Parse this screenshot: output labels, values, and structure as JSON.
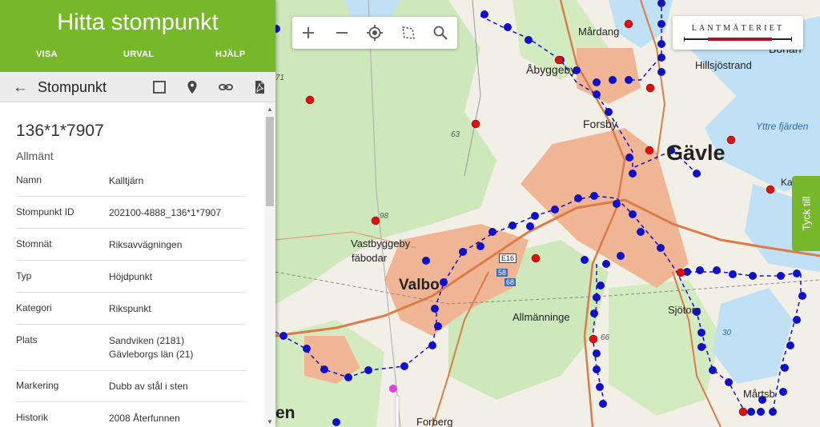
{
  "app": {
    "title": "Hitta stompunkt"
  },
  "nav": [
    {
      "label": "VISA"
    },
    {
      "label": "URVAL"
    },
    {
      "label": "HJÄLP"
    }
  ],
  "toolbar": {
    "title": "Stompunkt"
  },
  "point": {
    "id": "136*1*7907",
    "section": "Allmänt",
    "rows": [
      {
        "key": "Namn",
        "value": "Kalltjärn"
      },
      {
        "key": "Stompunkt ID",
        "value": "202100-4888_136*1*7907"
      },
      {
        "key": "Stomnät",
        "value": "Riksavvägningen"
      },
      {
        "key": "Typ",
        "value": "Höjdpunkt"
      },
      {
        "key": "Kategori",
        "value": "Rikspunkt"
      },
      {
        "key": "Plats",
        "value": "Sandviken (2181)",
        "value2": "Gävleborgs län (21)"
      },
      {
        "key": "Markering",
        "value": "Dubb av stål i sten"
      },
      {
        "key": "Historik",
        "value": "2008 Återfunnen"
      }
    ]
  },
  "logo": {
    "text": "LANTMÄTERIET"
  },
  "feedback": {
    "label": "Tyck till"
  },
  "map": {
    "labels": [
      {
        "text": "Mårdang"
      },
      {
        "text": "Åbyggeby"
      },
      {
        "text": "Hillsjöstrand"
      },
      {
        "text": "Bohan"
      },
      {
        "text": "Forsby"
      },
      {
        "text": "Gävle"
      },
      {
        "text": "Yttre fjärden"
      },
      {
        "text": "Vastbyggeby"
      },
      {
        "text": "fäbodar"
      },
      {
        "text": "Valbo"
      },
      {
        "text": "Allmänninge"
      },
      {
        "text": "Sjötorp"
      },
      {
        "text": "Mårtsb"
      },
      {
        "text": "Forberg"
      },
      {
        "text": "en"
      },
      {
        "text": "Ka"
      },
      {
        "text": "E16"
      },
      {
        "text": "58"
      },
      {
        "text": "68"
      },
      {
        "text": "63"
      },
      {
        "text": "98"
      },
      {
        "text": "66"
      },
      {
        "text": "30"
      },
      {
        "text": "71"
      }
    ],
    "colors": {
      "water": "#bfe0f5",
      "land": "#f2efe6",
      "forest": "#c9e6b4",
      "urban": "#f0b594",
      "road": "#d97d48",
      "point_blue": "#1010c8",
      "point_red": "#e01010",
      "point_magenta": "#e040e0"
    }
  }
}
